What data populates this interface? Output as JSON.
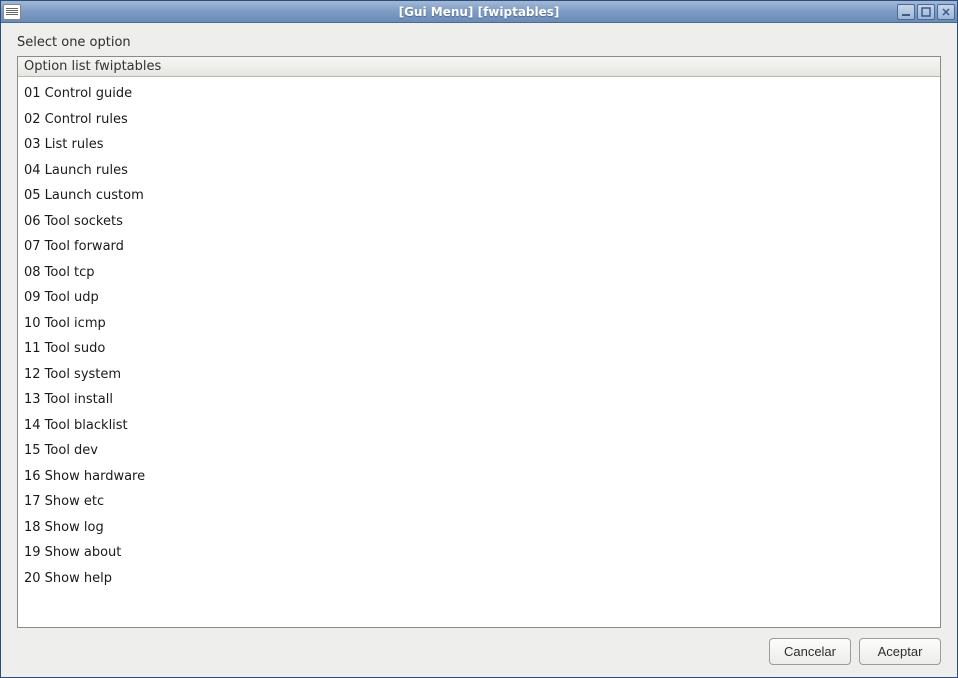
{
  "window": {
    "title": "[Gui Menu]  [fwiptables]"
  },
  "prompt": "Select one option",
  "list": {
    "header": "Option list fwiptables",
    "items": [
      "01 Control guide",
      "02 Control rules",
      "03 List rules",
      "04 Launch rules",
      "05 Launch custom",
      "06 Tool sockets",
      "07 Tool forward",
      "08 Tool tcp",
      "09 Tool udp",
      "10 Tool icmp",
      "11 Tool sudo",
      "12 Tool system",
      "13 Tool install",
      "14 Tool blacklist",
      "15 Tool dev",
      "16 Show hardware",
      "17 Show etc",
      "18 Show log",
      "19 Show about",
      "20 Show help"
    ]
  },
  "buttons": {
    "cancel": "Cancelar",
    "accept": "Aceptar"
  }
}
